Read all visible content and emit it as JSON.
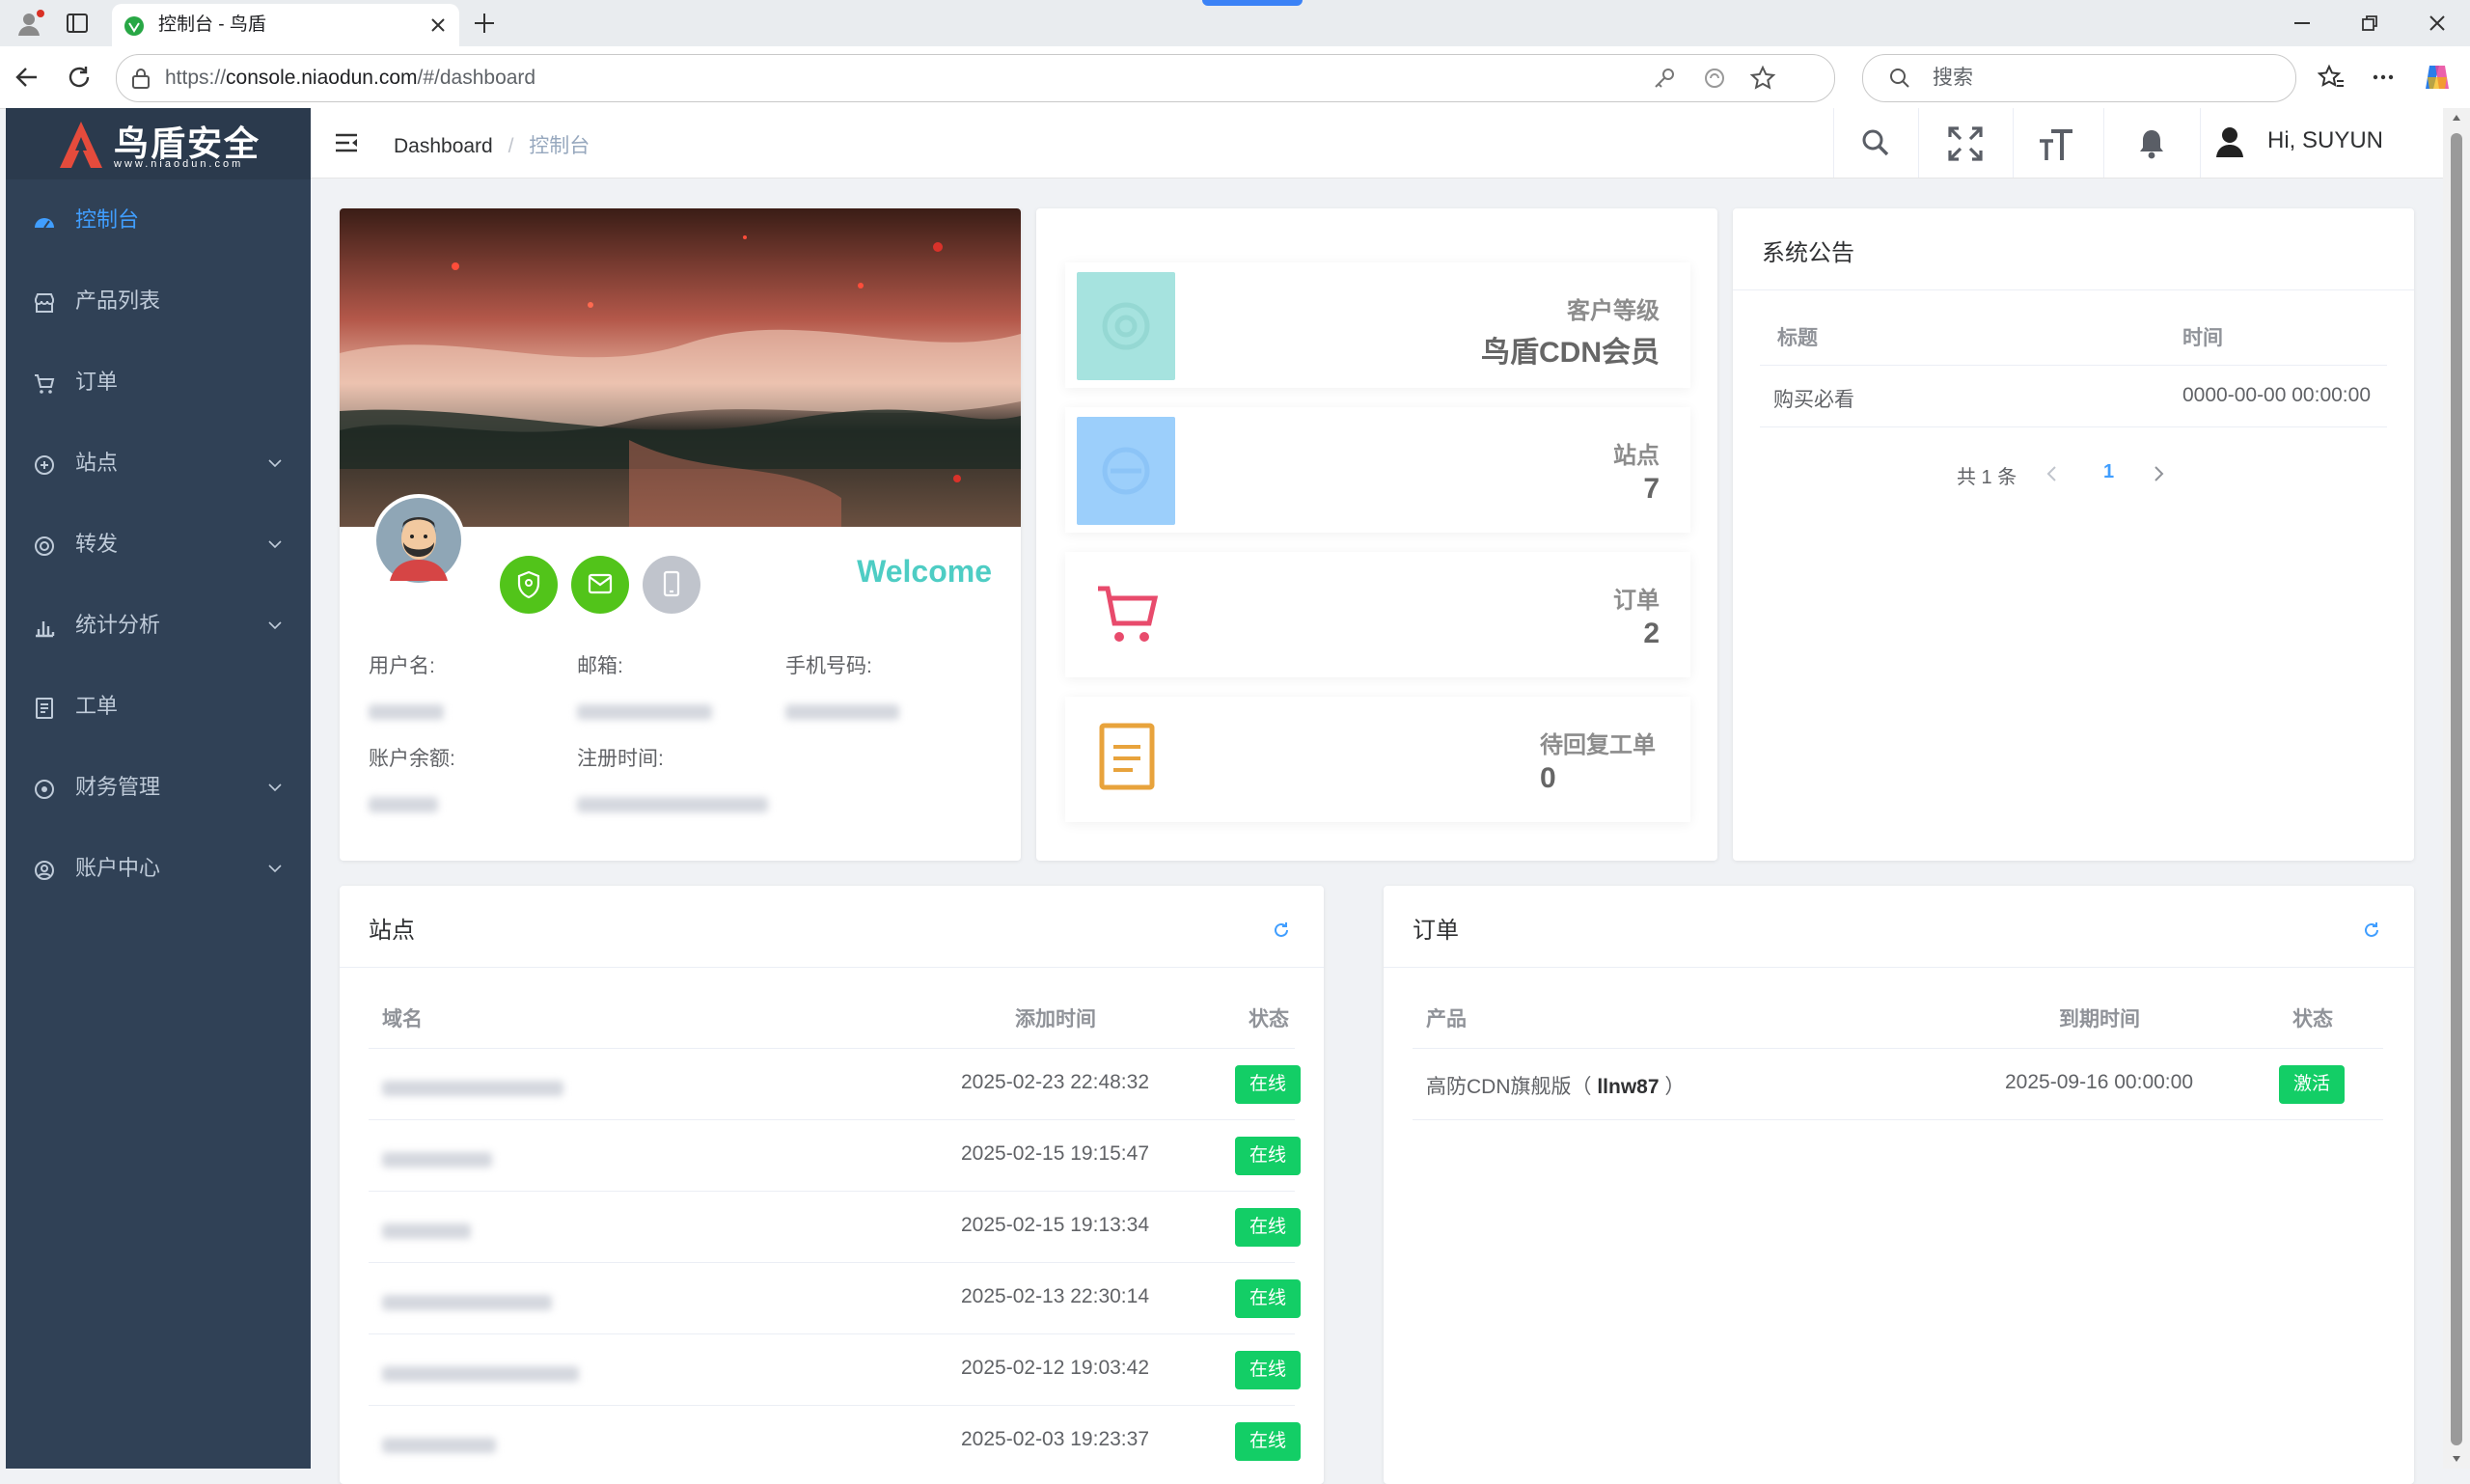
{
  "browser": {
    "tab_title": "控制台 - 鸟盾",
    "url_prefix": "https://",
    "url_host": "console.niaodun.com",
    "url_path": "/#/dashboard",
    "search_placeholder": "搜索"
  },
  "brand": {
    "name": "鸟盾安全",
    "domain": "www.niaodun.com"
  },
  "sidebar": {
    "items": [
      {
        "label": "控制台",
        "icon": "dashboard-icon",
        "active": true
      },
      {
        "label": "产品列表",
        "icon": "store-icon"
      },
      {
        "label": "订单",
        "icon": "cart-icon"
      },
      {
        "label": "站点",
        "icon": "site-icon",
        "expandable": true
      },
      {
        "label": "转发",
        "icon": "forward-icon",
        "expandable": true
      },
      {
        "label": "统计分析",
        "icon": "chart-icon",
        "expandable": true
      },
      {
        "label": "工单",
        "icon": "ticket-icon"
      },
      {
        "label": "财务管理",
        "icon": "finance-icon",
        "expandable": true
      },
      {
        "label": "账户中心",
        "icon": "account-icon",
        "expandable": true
      }
    ]
  },
  "header": {
    "breadcrumb_root": "Dashboard",
    "breadcrumb_separator": "/",
    "breadcrumb_current": "控制台",
    "greeting": "Hi, SUYUN"
  },
  "profile": {
    "welcome": "Welcome",
    "username_label": "用户名:",
    "email_label": "邮箱:",
    "phone_label": "手机号码:",
    "balance_label": "账户余额:",
    "register_label": "注册时间:"
  },
  "stats": [
    {
      "label": "客户等级",
      "value": "鸟盾CDN会员",
      "color": "#a6e3df"
    },
    {
      "label": "站点",
      "value": "7",
      "color": "#9ccffb"
    },
    {
      "label": "订单",
      "value": "2",
      "color": "#e84b6c"
    },
    {
      "label": "待回复工单",
      "value": "0",
      "color": "#e8a33c"
    }
  ],
  "notice": {
    "title": "系统公告",
    "col_title": "标题",
    "col_time": "时间",
    "rows": [
      {
        "title": "购买必看",
        "time": "0000-00-00 00:00:00"
      }
    ],
    "pagination_total": "共 1 条",
    "current_page": "1"
  },
  "sites": {
    "title": "站点",
    "col_domain": "域名",
    "col_added": "添加时间",
    "col_status": "状态",
    "rows": [
      {
        "added": "2025-02-23 22:48:32",
        "status": "在线"
      },
      {
        "added": "2025-02-15 19:15:47",
        "status": "在线"
      },
      {
        "added": "2025-02-15 19:13:34",
        "status": "在线"
      },
      {
        "added": "2025-02-13 22:30:14",
        "status": "在线"
      },
      {
        "added": "2025-02-12 19:03:42",
        "status": "在线"
      },
      {
        "added": "2025-02-03 19:23:37",
        "status": "在线"
      }
    ]
  },
  "orders": {
    "title": "订单",
    "col_product": "产品",
    "col_expire": "到期时间",
    "col_status": "状态",
    "rows": [
      {
        "product": "高防CDN旗舰版",
        "code": "llnw87",
        "expire": "2025-09-16 00:00:00",
        "status": "激活"
      }
    ]
  }
}
